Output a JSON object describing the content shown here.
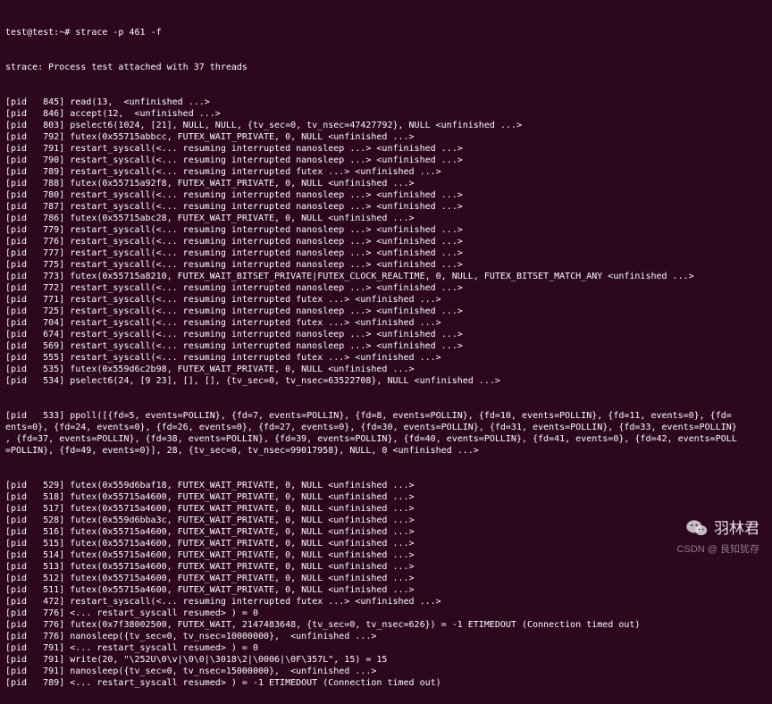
{
  "prompt": "test@test:~# strace -p 461 -f",
  "attach_message": "strace: Process test attached with 37 threads",
  "trace_lines": [
    {
      "pid": 845,
      "text": "read(13,  <unfinished ...>"
    },
    {
      "pid": 846,
      "text": "accept(12,  <unfinished ...>"
    },
    {
      "pid": 803,
      "text": "pselect6(1024, [21], NULL, NULL, {tv_sec=0, tv_nsec=47427792}, NULL <unfinished ...>"
    },
    {
      "pid": 792,
      "text": "futex(0x55715abbcc, FUTEX_WAIT_PRIVATE, 0, NULL <unfinished ...>"
    },
    {
      "pid": 791,
      "text": "restart_syscall(<... resuming interrupted nanosleep ...> <unfinished ...>"
    },
    {
      "pid": 790,
      "text": "restart_syscall(<... resuming interrupted nanosleep ...> <unfinished ...>"
    },
    {
      "pid": 789,
      "text": "restart_syscall(<... resuming interrupted futex ...> <unfinished ...>"
    },
    {
      "pid": 788,
      "text": "futex(0x55715a92f8, FUTEX_WAIT_PRIVATE, 0, NULL <unfinished ...>"
    },
    {
      "pid": 780,
      "text": "restart_syscall(<... resuming interrupted nanosleep ...> <unfinished ...>"
    },
    {
      "pid": 787,
      "text": "restart_syscall(<... resuming interrupted nanosleep ...> <unfinished ...>"
    },
    {
      "pid": 786,
      "text": "futex(0x55715abc28, FUTEX_WAIT_PRIVATE, 0, NULL <unfinished ...>"
    },
    {
      "pid": 779,
      "text": "restart_syscall(<... resuming interrupted nanosleep ...> <unfinished ...>"
    },
    {
      "pid": 776,
      "text": "restart_syscall(<... resuming interrupted nanosleep ...> <unfinished ...>"
    },
    {
      "pid": 777,
      "text": "restart_syscall(<... resuming interrupted nanosleep ...> <unfinished ...>"
    },
    {
      "pid": 775,
      "text": "restart_syscall(<... resuming interrupted nanosleep ...> <unfinished ...>"
    },
    {
      "pid": 773,
      "text": "futex(0x55715a8210, FUTEX_WAIT_BITSET_PRIVATE|FUTEX_CLOCK_REALTIME, 0, NULL, FUTEX_BITSET_MATCH_ANY <unfinished ...>"
    },
    {
      "pid": 772,
      "text": "restart_syscall(<... resuming interrupted nanosleep ...> <unfinished ...>"
    },
    {
      "pid": 771,
      "text": "restart_syscall(<... resuming interrupted futex ...> <unfinished ...>"
    },
    {
      "pid": 725,
      "text": "restart_syscall(<... resuming interrupted nanosleep ...> <unfinished ...>"
    },
    {
      "pid": 704,
      "text": "restart_syscall(<... resuming interrupted futex ...> <unfinished ...>"
    },
    {
      "pid": 674,
      "text": "restart_syscall(<... resuming interrupted nanosleep ...> <unfinished ...>"
    },
    {
      "pid": 569,
      "text": "restart_syscall(<... resuming interrupted nanosleep ...> <unfinished ...>"
    },
    {
      "pid": 555,
      "text": "restart_syscall(<... resuming interrupted futex ...> <unfinished ...>"
    },
    {
      "pid": 535,
      "text": "futex(0x559d6c2b98, FUTEX_WAIT_PRIVATE, 0, NULL <unfinished ...>"
    },
    {
      "pid": 534,
      "text": "pselect6(24, [9 23], [], [], {tv_sec=0, tv_nsec=63522708}, NULL <unfinished ...>"
    }
  ],
  "ppoll_block": {
    "pid": 533,
    "lines": [
      "ppoll([{fd=5, events=POLLIN}, {fd=7, events=POLLIN}, {fd=8, events=POLLIN}, {fd=10, events=POLLIN}, {fd=11, events=0}, {fd=",
      "ents=0}, {fd=24, events=0}, {fd=26, events=0}, {fd=27, events=0}, {fd=30, events=POLLIN}, {fd=31, events=POLLIN}, {fd=33, events=POLLIN}",
      ", {fd=37, events=POLLIN}, {fd=38, events=POLLIN}, {fd=39, events=POLLIN}, {fd=40, events=POLLIN}, {fd=41, events=0}, {fd=42, events=POLL",
      "=POLLIN}, {fd=49, events=0}], 28, {tv_sec=0, tv_nsec=99017958}, NULL, 0 <unfinished ...>"
    ]
  },
  "tail_lines": [
    {
      "pid": 529,
      "text": "futex(0x559d6baf18, FUTEX_WAIT_PRIVATE, 0, NULL <unfinished ...>"
    },
    {
      "pid": 518,
      "text": "futex(0x55715a4600, FUTEX_WAIT_PRIVATE, 0, NULL <unfinished ...>"
    },
    {
      "pid": 517,
      "text": "futex(0x55715a4600, FUTEX_WAIT_PRIVATE, 0, NULL <unfinished ...>"
    },
    {
      "pid": 528,
      "text": "futex(0x559d6bba3c, FUTEX_WAIT_PRIVATE, 0, NULL <unfinished ...>"
    },
    {
      "pid": 516,
      "text": "futex(0x55715a4600, FUTEX_WAIT_PRIVATE, 0, NULL <unfinished ...>"
    },
    {
      "pid": 515,
      "text": "futex(0x55715a4600, FUTEX_WAIT_PRIVATE, 0, NULL <unfinished ...>"
    },
    {
      "pid": 514,
      "text": "futex(0x55715a4600, FUTEX_WAIT_PRIVATE, 0, NULL <unfinished ...>"
    },
    {
      "pid": 513,
      "text": "futex(0x55715a4600, FUTEX_WAIT_PRIVATE, 0, NULL <unfinished ...>"
    },
    {
      "pid": 512,
      "text": "futex(0x55715a4600, FUTEX_WAIT_PRIVATE, 0, NULL <unfinished ...>"
    },
    {
      "pid": 511,
      "text": "futex(0x55715a4600, FUTEX_WAIT_PRIVATE, 0, NULL <unfinished ...>"
    },
    {
      "pid": 472,
      "text": "restart_syscall(<... resuming interrupted futex ...> <unfinished ...>"
    },
    {
      "pid": 776,
      "text": "<... restart_syscall resumed> ) = 0"
    },
    {
      "pid": 776,
      "text": "futex(0x7f38002500, FUTEX_WAIT, 2147483648, {tv_sec=0, tv_nsec=626}) = -1 ETIMEDOUT (Connection timed out)"
    },
    {
      "pid": 776,
      "text": "nanosleep({tv_sec=0, tv_nsec=10000000},  <unfinished ...>"
    },
    {
      "pid": 791,
      "text": "<... restart_syscall resumed> ) = 0"
    },
    {
      "pid": 791,
      "text": "write(20, \"\\252U\\0\\v|\\0\\0|\\3018\\2|\\0006|\\0F\\357L\", 15) = 15"
    },
    {
      "pid": 791,
      "text": "nanosleep({tv_sec=0, tv_nsec=15000000},  <unfinished ...>"
    },
    {
      "pid": 789,
      "text": "<... restart_syscall resumed> ) = -1 ETIMEDOUT (Connection timed out)"
    }
  ],
  "watermark": {
    "text": "羽林君",
    "csdn": "CSDN @ 良知犹存"
  }
}
